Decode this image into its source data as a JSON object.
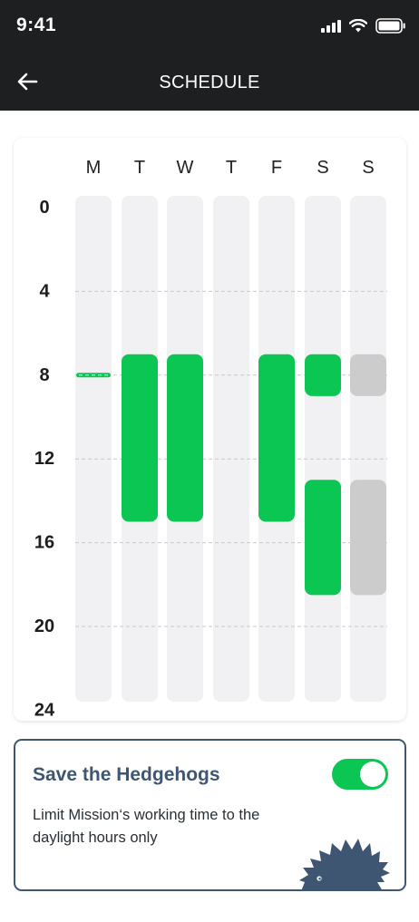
{
  "status_bar": {
    "time": "9:41"
  },
  "app_bar": {
    "title": "SCHEDULE",
    "back_icon": "arrow-left-icon"
  },
  "schedule": {
    "days": [
      "M",
      "T",
      "W",
      "T",
      "F",
      "S",
      "S"
    ],
    "hour_labels": [
      "0",
      "4",
      "8",
      "12",
      "16",
      "20",
      "24"
    ],
    "hours_total": 24,
    "colors": {
      "active": "#0cc653",
      "inactive": "#cccccc",
      "track": "#f1f1f4"
    },
    "blocks": [
      {
        "day": 0,
        "start": 7.95,
        "end": 8.05,
        "style": "dashed-active"
      },
      {
        "day": 1,
        "start": 7,
        "end": 15,
        "style": "active"
      },
      {
        "day": 2,
        "start": 7,
        "end": 15,
        "style": "active"
      },
      {
        "day": 4,
        "start": 7,
        "end": 15,
        "style": "active"
      },
      {
        "day": 5,
        "start": 7,
        "end": 9,
        "style": "active"
      },
      {
        "day": 5,
        "start": 13,
        "end": 18.5,
        "style": "active"
      },
      {
        "day": 6,
        "start": 7,
        "end": 9,
        "style": "inactive"
      },
      {
        "day": 6,
        "start": 13,
        "end": 18.5,
        "style": "inactive"
      }
    ]
  },
  "hedgehog_card": {
    "title": "Save the Hedgehogs",
    "description": "Limit Mission‘s working time to the daylight hours only",
    "toggle_on": true,
    "toggle_color": "#0cc653",
    "accent_color": "#3f5673",
    "illustration_icon": "hedgehog-icon"
  }
}
